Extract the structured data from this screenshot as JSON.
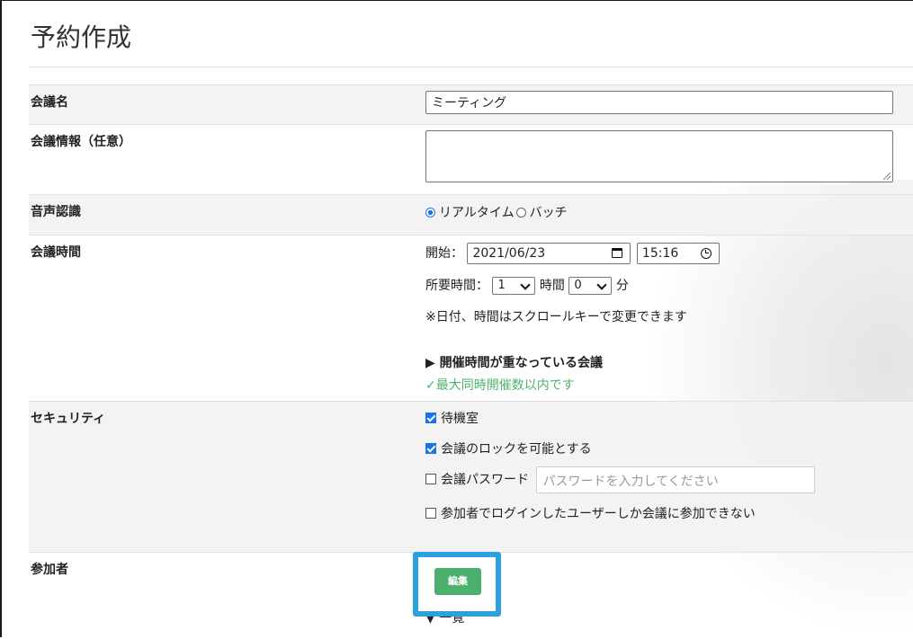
{
  "page": {
    "title": "予約作成"
  },
  "rows": {
    "name": {
      "label": "会議名",
      "value": "ミーティング"
    },
    "info": {
      "label": "会議情報（任意）",
      "value": ""
    },
    "speech": {
      "label": "音声認識",
      "options": [
        "リアルタイム",
        "バッチ"
      ],
      "selected": "リアルタイム"
    },
    "time": {
      "label": "会議時間",
      "start_label": "開始：",
      "date": "2021/06/23",
      "time": "15:16",
      "duration_label": "所要時間：",
      "hours": "1",
      "hours_unit": "時間",
      "minutes": "0",
      "minutes_unit": "分",
      "note": "※日付、時間はスクロールキーで変更できます",
      "overlap_toggle": "▶ 開催時間が重なっている会議",
      "status": "✓最大同時開催数以内です"
    },
    "security": {
      "label": "セキュリティ",
      "waiting_room": {
        "label": "待機室",
        "checked": true
      },
      "lock": {
        "label": "会議のロックを可能とする",
        "checked": true
      },
      "password": {
        "label": "会議パスワード",
        "checked": false,
        "placeholder": "パスワードを入力してください"
      },
      "login_only": {
        "label": "参加者でログインしたユーザーしか会議に参加できない",
        "checked": false
      }
    },
    "participants": {
      "label": "参加者",
      "edit_label": "編集",
      "list_toggle": "▼ 一覧"
    }
  },
  "colors": {
    "accent": "#1a73e8",
    "edit_button": "#4caf6e",
    "highlight": "#2da0e0",
    "ok_text": "#4fb36a"
  }
}
